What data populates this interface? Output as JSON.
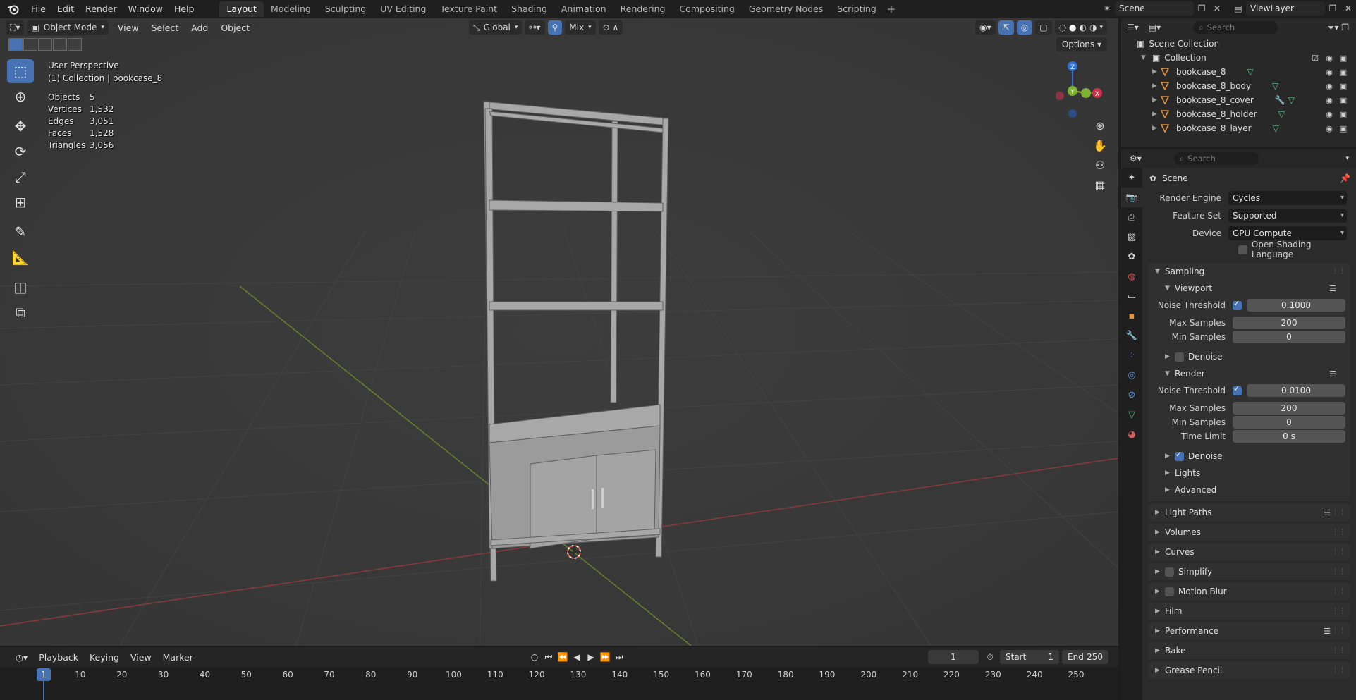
{
  "topbar": {
    "menus": [
      "File",
      "Edit",
      "Render",
      "Window",
      "Help"
    ],
    "workspaces": [
      "Layout",
      "Modeling",
      "Sculpting",
      "UV Editing",
      "Texture Paint",
      "Shading",
      "Animation",
      "Rendering",
      "Compositing",
      "Geometry Nodes",
      "Scripting"
    ],
    "active_workspace": "Layout",
    "add_tab": "+",
    "scene_name": "Scene",
    "view_layer": "ViewLayer"
  },
  "viewport": {
    "mode": "Object Mode",
    "menus": [
      "View",
      "Select",
      "Add",
      "Object"
    ],
    "orientation": "Global",
    "snap_mix": "Mix",
    "options_label": "Options",
    "perspective_label": "User Perspective",
    "collection_label": "(1) Collection | bookcase_8",
    "stats": [
      {
        "key": "Objects",
        "value": "5"
      },
      {
        "key": "Vertices",
        "value": "1,532"
      },
      {
        "key": "Edges",
        "value": "3,051"
      },
      {
        "key": "Faces",
        "value": "1,528"
      },
      {
        "key": "Triangles",
        "value": "3,056"
      }
    ],
    "gizmo_axes": {
      "x": "X",
      "y": "Y",
      "z": "Z"
    }
  },
  "timeline": {
    "menus": [
      "Playback",
      "Keying",
      "View",
      "Marker"
    ],
    "current_frame": "1",
    "start_label": "Start",
    "start": "1",
    "end_label": "End",
    "end": "250",
    "ticks": [
      "1",
      "10",
      "20",
      "30",
      "40",
      "50",
      "60",
      "70",
      "80",
      "90",
      "100",
      "110",
      "120",
      "130",
      "140",
      "150",
      "160",
      "170",
      "180",
      "190",
      "200",
      "210",
      "220",
      "230",
      "240",
      "250"
    ]
  },
  "outliner": {
    "search_placeholder": "Search",
    "root": "Scene Collection",
    "collection": "Collection",
    "items": [
      "bookcase_8",
      "bookcase_8_body",
      "bookcase_8_cover",
      "bookcase_8_holder",
      "bookcase_8_layer"
    ]
  },
  "properties": {
    "search_placeholder": "Search",
    "context_title": "Scene",
    "render_engine_label": "Render Engine",
    "render_engine": "Cycles",
    "feature_set_label": "Feature Set",
    "feature_set": "Supported",
    "device_label": "Device",
    "device": "GPU Compute",
    "osl_label": "Open Shading Language",
    "sampling": {
      "title": "Sampling",
      "viewport": {
        "title": "Viewport",
        "noise_threshold_label": "Noise Threshold",
        "noise_threshold": "0.1000",
        "max_samples_label": "Max Samples",
        "max_samples": "200",
        "min_samples_label": "Min Samples",
        "min_samples": "0",
        "denoise_label": "Denoise"
      },
      "render": {
        "title": "Render",
        "noise_threshold_label": "Noise Threshold",
        "noise_threshold": "0.0100",
        "max_samples_label": "Max Samples",
        "max_samples": "200",
        "min_samples_label": "Min Samples",
        "min_samples": "0",
        "time_limit_label": "Time Limit",
        "time_limit": "0 s",
        "denoise_label": "Denoise"
      },
      "lights_label": "Lights",
      "advanced_label": "Advanced"
    },
    "panels": [
      "Light Paths",
      "Volumes",
      "Curves",
      "Simplify",
      "Motion Blur",
      "Film",
      "Performance",
      "Bake",
      "Grease Pencil"
    ]
  }
}
